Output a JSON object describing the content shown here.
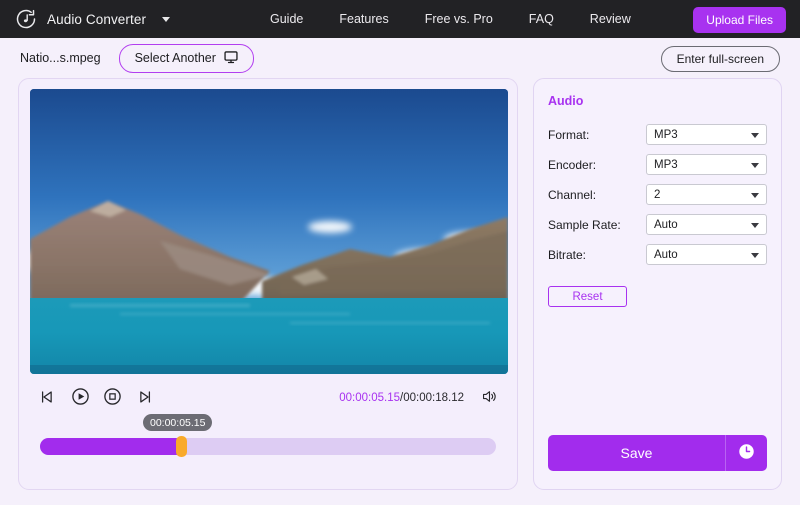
{
  "topbar": {
    "logo_icon": "music-note-circle-icon",
    "brand": "Audio Converter",
    "caret_icon": "chevron-down-icon",
    "nav": [
      {
        "label": "Guide"
      },
      {
        "label": "Features"
      },
      {
        "label": "Free vs. Pro"
      },
      {
        "label": "FAQ"
      },
      {
        "label": "Review"
      }
    ],
    "upload_label": "Upload Files",
    "accent": "#a832f0",
    "background": "#222225"
  },
  "filerow": {
    "filename": "Natio...s.mpeg",
    "select_another_label": "Select Another",
    "select_another_icon": "monitor-icon",
    "fullscreen_label": "Enter full-screen"
  },
  "player": {
    "controls": [
      {
        "name": "previous-frame-button",
        "icon": "rewind-icon"
      },
      {
        "name": "play-button",
        "icon": "play-circle-icon"
      },
      {
        "name": "stop-button",
        "icon": "stop-circle-icon"
      },
      {
        "name": "next-frame-button",
        "icon": "forward-icon"
      }
    ],
    "current_time": "00:00:05.15",
    "time_separator": "/",
    "total_time": "00:00:18.12",
    "volume_icon": "speaker-icon",
    "tooltip_time": "00:00:05.15",
    "progress_percent": 30.5,
    "handle_color": "#f9aa2b",
    "fill_color": "#a22ced",
    "track_color": "#ddccf3"
  },
  "settings": {
    "title": "Audio",
    "title_color": "#a832f0",
    "fields": [
      {
        "label": "Format:",
        "value": "MP3"
      },
      {
        "label": "Encoder:",
        "value": "MP3"
      },
      {
        "label": "Channel:",
        "value": "2"
      },
      {
        "label": "Sample Rate:",
        "value": "Auto"
      },
      {
        "label": "Bitrate:",
        "value": "Auto"
      }
    ],
    "reset_label": "Reset",
    "save_label": "Save",
    "save_schedule_icon": "clock-icon"
  }
}
